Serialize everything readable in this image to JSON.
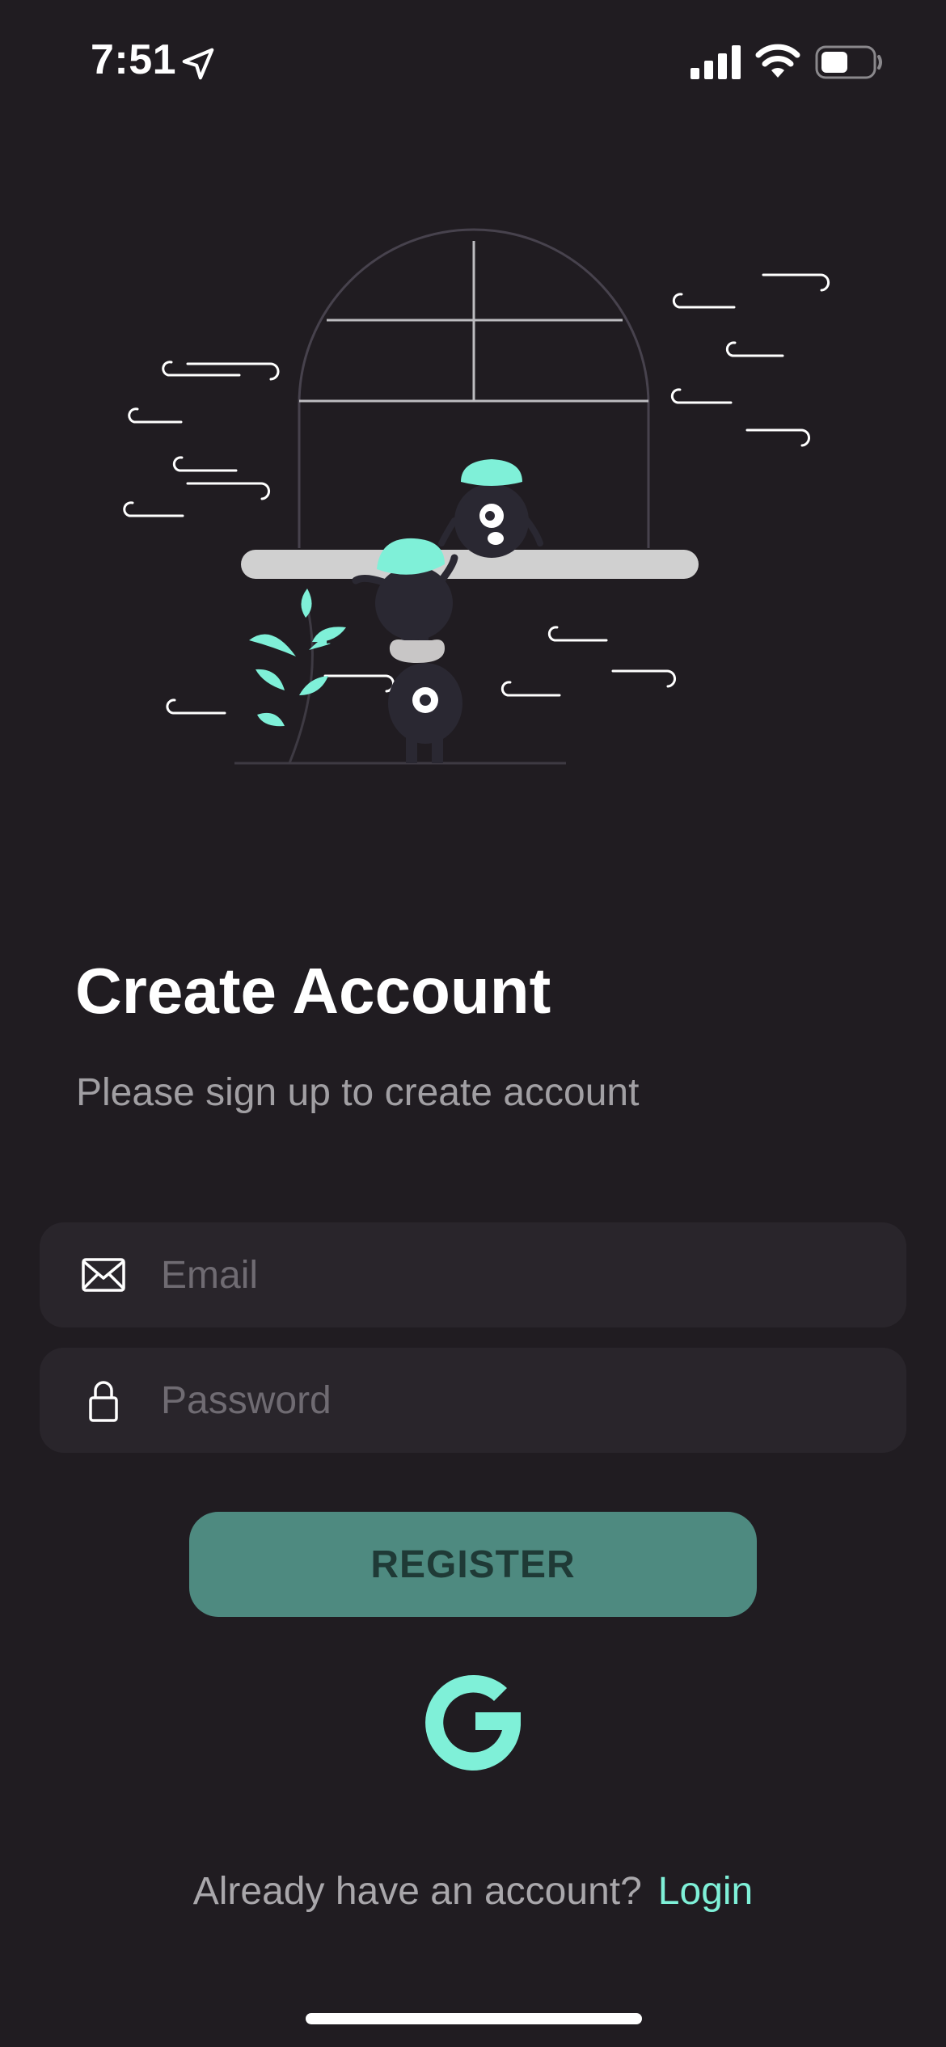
{
  "status_bar": {
    "time": "7:51",
    "icons": [
      "location-arrow-icon",
      "cellular-signal-icon",
      "wifi-icon",
      "battery-icon"
    ]
  },
  "illustration": {
    "name": "monsters-at-window-illustration"
  },
  "header": {
    "title": "Create Account",
    "subtitle": "Please sign up to create account"
  },
  "form": {
    "email": {
      "placeholder": "Email",
      "value": "",
      "icon": "mail-icon"
    },
    "password": {
      "placeholder": "Password",
      "value": "",
      "icon": "lock-icon"
    }
  },
  "register_button": {
    "label": "REGISTER"
  },
  "google_button": {
    "icon": "google-icon"
  },
  "footer": {
    "prompt": "Already have an account?",
    "login_label": "Login"
  },
  "colors": {
    "background": "#201c21",
    "field_background": "#29252b",
    "accent": "#7ff0d8",
    "button": "#4e8a80",
    "button_text": "#1f3a36"
  }
}
